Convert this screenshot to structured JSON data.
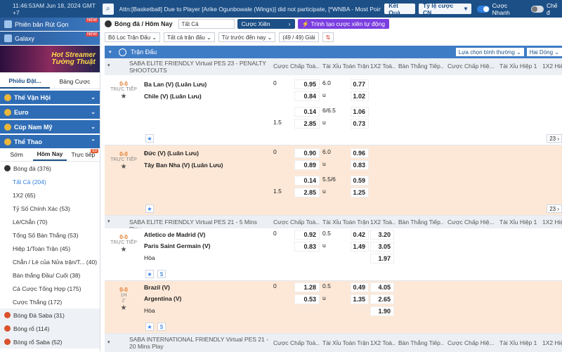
{
  "topbar": {
    "time": "11:46:53AM Jun 18, 2024 GMT +7",
    "marquee": "Attn:[Basketball] Due to Player [Arike Ogunbowale (Wings)] did not participate, [*WNBA - Most Points",
    "results_label": "Kết Quả",
    "odds_format": "Tỷ lệ cược CN",
    "quick_bet": "Cược Nhanh",
    "toggle2": "Chế đ"
  },
  "sidebar": {
    "ad1": "Phiên bản Rút Gọn",
    "ad2": "Galaxy",
    "ad_badge": "NEW",
    "banner_line1": "Hot Streamer",
    "banner_line2": "Tường Thuật",
    "tab_slip": "Phiếu Đặt...",
    "tab_table": "Bảng Cược",
    "cats": [
      "Thế Vận Hội",
      "Euro",
      "Cúp Nam Mỹ",
      "Thể Thao"
    ],
    "subtabs": [
      "Sớm",
      "Hôm Nay",
      "Trực tiếp"
    ],
    "live_count": "83",
    "sport": "Bóng đá  (376)",
    "items": [
      "Tất Cả  (204)",
      "1X2  (65)",
      "Tỷ Số Chính Xác  (53)",
      "Lẻ/Chẵn  (70)",
      "Tổng Số Bàn Thắng  (53)",
      "Hiệp 1/Toàn Trận  (45)",
      "Chẵn / Lẻ của Nửa trận/T...  (40)",
      "Bàn thắng Đầu/ Cuối  (38)",
      "Cá Cược Tổng Hợp  (175)",
      "Cược Thắng  (172)"
    ],
    "sports2": [
      "Bóng Đá Saba  (31)",
      "Bóng rổ  (114)",
      "Bóng rổ Saba  (52)"
    ]
  },
  "main": {
    "crumb": "Bóng đá / Hôm Nay",
    "sel_all": "Tất Cả",
    "xien": "Cược Xiên",
    "xien_auto": "Trình tạo cược xiên tự động",
    "f1": "Bộ Lọc Trận Đấu",
    "f2": "Tất cả trận đấu",
    "f3": "Từ trước đến nay",
    "count": "(49 / 49) Giải",
    "sort": "⇅",
    "head": "Trận Đấu",
    "sort_label": "Lựa chọn bình thường",
    "view": "Hai Dòng",
    "cols": [
      "Cược Chấp Toà...",
      "Tài Xỉu Toàn Trận",
      "1X2 Toà...",
      "Bàn Thắng Tiếp...",
      "Cược Chấp Hiệ...",
      "Tài Xỉu Hiệp 1",
      "1X2 Hiệ..."
    ],
    "league1": "SABA ELITE FRIENDLY Virtual PES 23 - PENALTY SHOOTOUTS",
    "m1": {
      "score": "0-0",
      "live": "TRỰC TIẾP",
      "home": "Ba Lan (V) (Luân Lưu)",
      "away": "Chile (V) (Luân Lưu)",
      "r": [
        [
          "0",
          "0.95",
          "6.0",
          "0.77"
        ],
        [
          "",
          "0.84",
          "u",
          "1.02"
        ],
        [
          "",
          "0.14",
          "6/6.5",
          "1.06"
        ],
        [
          "1.5",
          "2.85",
          "u",
          "0.73"
        ]
      ],
      "more": "23"
    },
    "m2": {
      "score": "0-0",
      "live": "TRỰC TIẾP",
      "home": "Đức (V) (Luân Lưu)",
      "away": "Tây Ban Nha (V) (Luân Lưu)",
      "r": [
        [
          "0",
          "0.90",
          "6.0",
          "0.96"
        ],
        [
          "",
          "0.89",
          "u",
          "0.83"
        ],
        [
          "",
          "0.14",
          "5.5/6",
          "0.59"
        ],
        [
          "1.5",
          "2.85",
          "u",
          "1.25"
        ]
      ],
      "more": "23"
    },
    "league2": "SABA ELITE FRIENDLY Virtual PES 21 - 5 Mins Play",
    "m3": {
      "score": "0-0",
      "live": "TRỰC TIẾP",
      "home": "Atletico de Madrid (V)",
      "away": "Paris Saint Germain (V)",
      "draw": "Hòa",
      "r": [
        [
          "0",
          "0.92",
          "0.5",
          "0.42",
          "3.20"
        ],
        [
          "",
          "0.83",
          "u",
          "1.49",
          "3.05"
        ],
        [
          "",
          "",
          "",
          "",
          "1.97"
        ]
      ]
    },
    "m4": {
      "score": "0-0",
      "live": "1H",
      "min": "2'",
      "home": "Brazil (V)",
      "away": "Argentina (V)",
      "draw": "Hòa",
      "r": [
        [
          "0",
          "1.28",
          "0.5",
          "0.49",
          "4.05"
        ],
        [
          "",
          "0.53",
          "u",
          "1.35",
          "2.65"
        ],
        [
          "",
          "",
          "",
          "",
          "1.90"
        ]
      ]
    },
    "league3": "SABA INTERNATIONAL FRIENDLY Virtual PES 21 - 20 Mins Play"
  }
}
